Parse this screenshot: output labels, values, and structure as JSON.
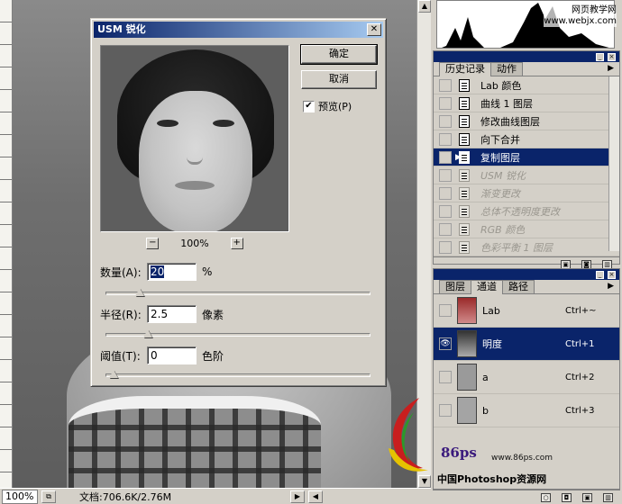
{
  "dialog": {
    "title": "USM 锐化",
    "ok": "确定",
    "cancel": "取消",
    "preview_label": "预览(P)",
    "preview_checked": true,
    "zoom_minus": "−",
    "zoom_plus": "+",
    "zoom_level": "100%",
    "amount": {
      "label": "数量(A):",
      "value": "20",
      "unit": "%",
      "slider_fraction": 0.1
    },
    "radius": {
      "label": "半径(R):",
      "value": "2.5",
      "unit": "像素",
      "slider_fraction": 0.13
    },
    "threshold": {
      "label": "阈值(T):",
      "value": "0",
      "unit": "色阶",
      "slider_fraction": 0.0
    }
  },
  "history_panel": {
    "tabs": [
      "历史记录",
      "动作"
    ],
    "items": [
      {
        "label": "Lab 颜色",
        "state": "normal"
      },
      {
        "label": "曲线 1 图层",
        "state": "normal"
      },
      {
        "label": "修改曲线图层",
        "state": "normal"
      },
      {
        "label": "向下合并",
        "state": "normal"
      },
      {
        "label": "复制图层",
        "state": "selected"
      },
      {
        "label": "USM 锐化",
        "state": "dim"
      },
      {
        "label": "渐变更改",
        "state": "dim"
      },
      {
        "label": "总体不透明度更改",
        "state": "dim"
      },
      {
        "label": "RGB 颜色",
        "state": "dim"
      },
      {
        "label": "色彩平衡 1 图层",
        "state": "dim"
      }
    ]
  },
  "channels_panel": {
    "tabs": [
      "图层",
      "通道",
      "路径"
    ],
    "items": [
      {
        "name": "Lab",
        "shortcut": "Ctrl+~",
        "visible": false,
        "selected": false
      },
      {
        "name": "明度",
        "shortcut": "Ctrl+1",
        "visible": true,
        "selected": true
      },
      {
        "name": "a",
        "shortcut": "Ctrl+2",
        "visible": false,
        "selected": false
      },
      {
        "name": "b",
        "shortcut": "Ctrl+3",
        "visible": false,
        "selected": false
      }
    ]
  },
  "status": {
    "zoom": "100%",
    "doc_info": "文档:706.6K/2.76M"
  },
  "watermark": {
    "top_line1": "网页教学网",
    "top_line2": "www.webjx.com",
    "logo_text": "86ps",
    "url": "www.86ps.com",
    "cn": "中国Photoshop资源网"
  },
  "colors": {
    "title_bar": "#0a246a",
    "selection": "#0a246a",
    "dialog_bg": "#d4d0c8"
  }
}
